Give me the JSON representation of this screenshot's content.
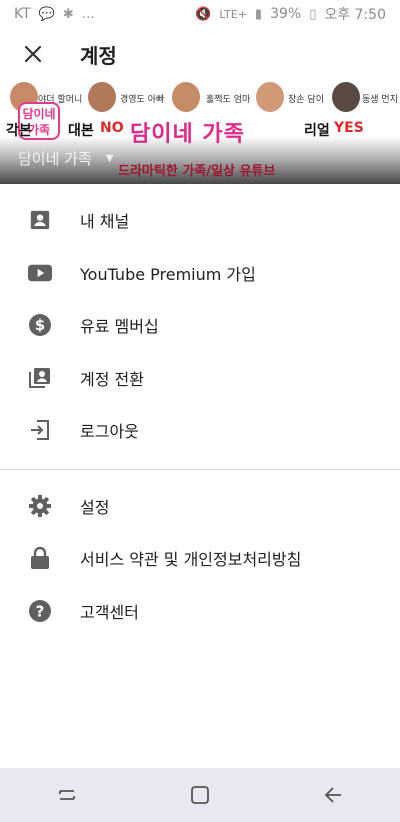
{
  "status": {
    "carrier": "KT",
    "network": "LTE+",
    "battery": "39%",
    "time": "오후 7:50"
  },
  "appbar": {
    "title": "계정"
  },
  "banner": {
    "logo_text": "담이네 가족",
    "left_text": "각본",
    "mid_text": "대본",
    "no_text": "NO",
    "big_text": "담이네 가족",
    "right_text": "리얼",
    "yes_text": "YES",
    "subtitle": "드라마틱한 가족/일상 유튜브",
    "labels": [
      "야더 할머니",
      "경영도 아빠",
      "훌쩍도 엄마",
      "장손 담이",
      "동생 먼지"
    ]
  },
  "account": {
    "name": "담이네 가족"
  },
  "menu_primary": [
    {
      "label": "내 채널",
      "icon": "account-box-icon"
    },
    {
      "label": "YouTube Premium 가입",
      "icon": "youtube-icon"
    },
    {
      "label": "유료 멤버십",
      "icon": "paid-membership-icon"
    },
    {
      "label": "계정 전환",
      "icon": "switch-account-icon"
    },
    {
      "label": "로그아웃",
      "icon": "sign-out-icon"
    }
  ],
  "menu_secondary": [
    {
      "label": "설정",
      "icon": "gear-icon"
    },
    {
      "label": "서비스 약관 및 개인정보처리방침",
      "icon": "lock-icon"
    },
    {
      "label": "고객센터",
      "icon": "help-icon"
    }
  ]
}
